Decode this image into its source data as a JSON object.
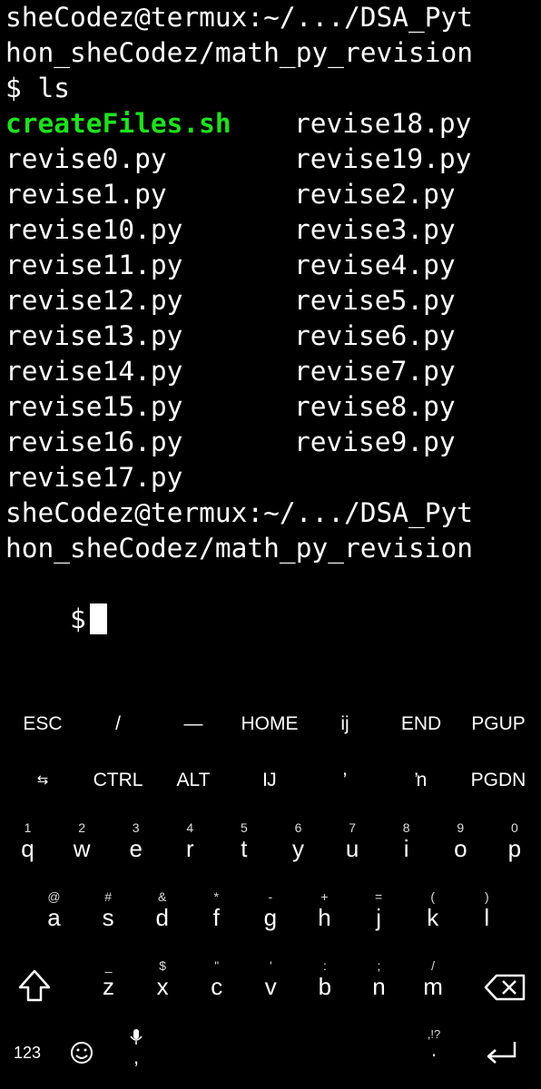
{
  "terminal": {
    "prompt_line1": "sheCodez@termux:~/.../DSA_Pyt",
    "prompt_line2": "hon_sheCodez/math_py_revision",
    "command_line": "$ ls",
    "files_col1": [
      "createFiles.sh",
      "revise0.py",
      "revise1.py",
      "revise10.py",
      "revise11.py",
      "revise12.py",
      "revise13.py",
      "revise14.py",
      "revise15.py",
      "revise16.py",
      "revise17.py"
    ],
    "files_col2": [
      "revise18.py",
      "revise19.py",
      "revise2.py",
      "revise3.py",
      "revise4.py",
      "revise5.py",
      "revise6.py",
      "revise7.py",
      "revise8.py",
      "revise9.py"
    ],
    "prompt2_line1": "sheCodez@termux:~/.../DSA_Pyt",
    "prompt2_line2": "hon_sheCodez/math_py_revision",
    "prompt_symbol": "$",
    "colors": {
      "executable": "#1fe01f",
      "text": "#ffffff",
      "background": "#000000"
    }
  },
  "extra_keys": {
    "row1": [
      "ESC",
      "/",
      "—",
      "HOME",
      "ij",
      "END",
      "PGUP"
    ],
    "row2": [
      "⇆",
      "CTRL",
      "ALT",
      "Ĳ",
      "’",
      "ŉ",
      "PGDN"
    ]
  },
  "keyboard": {
    "row1": [
      {
        "hint": "1",
        "main": "q"
      },
      {
        "hint": "2",
        "main": "w"
      },
      {
        "hint": "3",
        "main": "e"
      },
      {
        "hint": "4",
        "main": "r"
      },
      {
        "hint": "5",
        "main": "t"
      },
      {
        "hint": "6",
        "main": "y"
      },
      {
        "hint": "7",
        "main": "u"
      },
      {
        "hint": "8",
        "main": "i"
      },
      {
        "hint": "9",
        "main": "o"
      },
      {
        "hint": "0",
        "main": "p"
      }
    ],
    "row2": [
      {
        "hint": "@",
        "main": "a"
      },
      {
        "hint": "#",
        "main": "s"
      },
      {
        "hint": "&",
        "main": "d"
      },
      {
        "hint": "*",
        "main": "f"
      },
      {
        "hint": "-",
        "main": "g"
      },
      {
        "hint": "+",
        "main": "h"
      },
      {
        "hint": "=",
        "main": "j"
      },
      {
        "hint": "(",
        "main": "k"
      },
      {
        "hint": ")",
        "main": "l"
      }
    ],
    "row3": [
      {
        "hint": "_",
        "main": "z"
      },
      {
        "hint": "$",
        "main": "x"
      },
      {
        "hint": "\"",
        "main": "c"
      },
      {
        "hint": "'",
        "main": "v"
      },
      {
        "hint": ":",
        "main": "b"
      },
      {
        "hint": ";",
        "main": "n"
      },
      {
        "hint": "/",
        "main": "m"
      }
    ],
    "shift_icon": "shift-icon",
    "backspace_icon": "backspace-icon",
    "num_label": "123",
    "emoji_icon": "emoji-icon",
    "mic_icon": "mic-icon",
    "comma_label": ",",
    "punct_hint": ",!?",
    "period_label": ".",
    "enter_icon": "enter-icon"
  }
}
